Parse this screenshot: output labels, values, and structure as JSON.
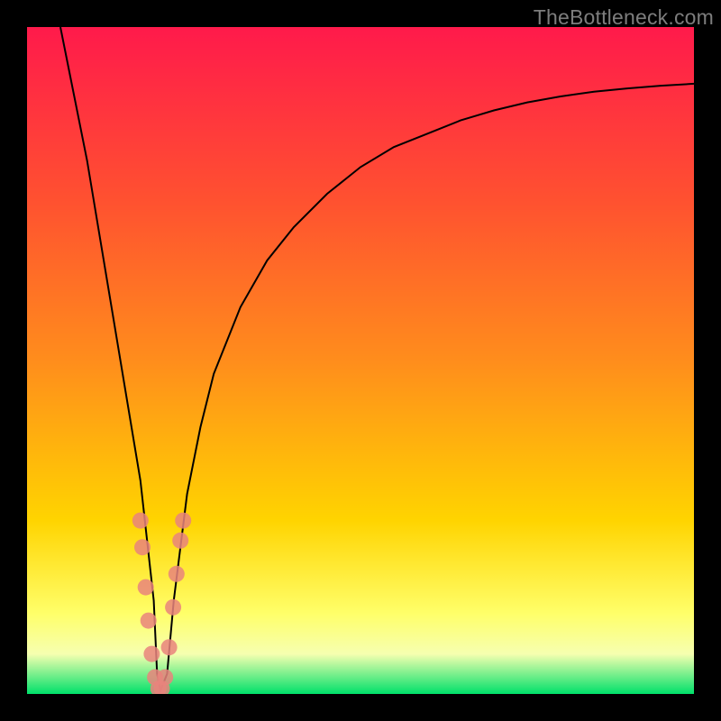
{
  "watermark": "TheBottleneck.com",
  "colors": {
    "frame": "#000000",
    "curve": "#000000",
    "marker_fill": "#e9847d",
    "marker_stroke": "#e9847d",
    "grad_top": "#ff1a4b",
    "grad_1": "#ff5130",
    "grad_2": "#ff8d1c",
    "grad_3": "#ffd400",
    "grad_band_top": "#ffff6a",
    "grad_band_mid": "#f6ffb0",
    "grad_bottom": "#00e06a"
  },
  "chart_data": {
    "type": "line",
    "title": "",
    "xlabel": "",
    "ylabel": "",
    "xlim": [
      0,
      100
    ],
    "ylim": [
      0,
      100
    ],
    "note": "Axes are unlabeled; values estimated from pixel positions on a 0–100 normalized grid (0,0 at bottom-left).",
    "series": [
      {
        "name": "bottleneck-curve",
        "x": [
          5,
          7,
          9,
          11,
          13,
          15,
          17,
          19,
          19.5,
          20,
          21,
          22,
          24,
          26,
          28,
          32,
          36,
          40,
          45,
          50,
          55,
          60,
          65,
          70,
          75,
          80,
          85,
          90,
          95,
          100
        ],
        "y": [
          100,
          90,
          80,
          68,
          56,
          44,
          32,
          14,
          3,
          0.5,
          3,
          14,
          30,
          40,
          48,
          58,
          65,
          70,
          75,
          79,
          82,
          84,
          86,
          87.5,
          88.7,
          89.6,
          90.3,
          90.8,
          91.2,
          91.5
        ]
      }
    ],
    "markers": {
      "name": "highlighted-points",
      "points": [
        {
          "x": 17.0,
          "y": 26
        },
        {
          "x": 17.3,
          "y": 22
        },
        {
          "x": 17.8,
          "y": 16
        },
        {
          "x": 18.2,
          "y": 11
        },
        {
          "x": 18.7,
          "y": 6
        },
        {
          "x": 19.2,
          "y": 2.5
        },
        {
          "x": 19.7,
          "y": 0.8
        },
        {
          "x": 20.2,
          "y": 0.8
        },
        {
          "x": 20.7,
          "y": 2.5
        },
        {
          "x": 21.3,
          "y": 7
        },
        {
          "x": 21.9,
          "y": 13
        },
        {
          "x": 22.4,
          "y": 18
        },
        {
          "x": 23.0,
          "y": 23
        },
        {
          "x": 23.4,
          "y": 26
        }
      ]
    },
    "minimum": {
      "x": 20,
      "y": 0
    }
  }
}
